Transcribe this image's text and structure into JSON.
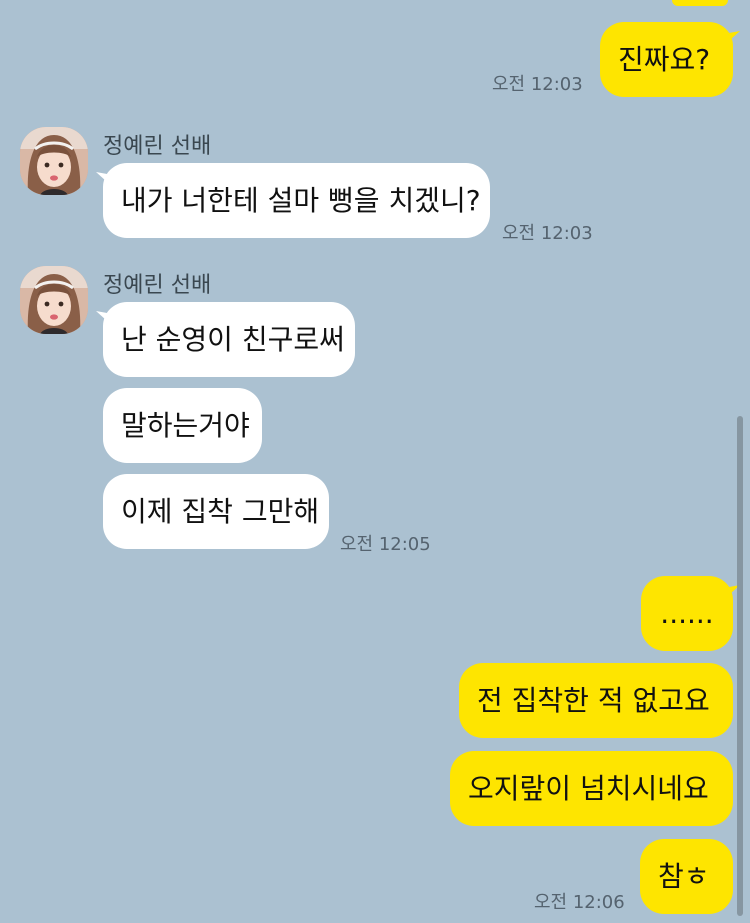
{
  "messages": {
    "out_top": {
      "text": "진짜요?",
      "time": "오전 12:03"
    },
    "group1": {
      "sender": "정예린 선배",
      "text": "내가 너한테 설마 뻥을 치겠니?",
      "time": "오전 12:03"
    },
    "group2": {
      "sender": "정예린 선배",
      "texts": [
        "난 순영이 친구로써",
        "말하는거야",
        "이제 집착 그만해"
      ],
      "time": "오전 12:05"
    },
    "out_bottom": {
      "texts": [
        "......",
        "전 집착한 적 없고요",
        "오지랖이 넘치시네요",
        "참ㅎ"
      ],
      "time": "오전 12:06"
    }
  },
  "colors": {
    "background": "#abc1d1",
    "my_bubble": "#fee500",
    "their_bubble": "#ffffff"
  },
  "icons": {
    "avatar": "profile-photo",
    "scrollbar": "vertical-scroll-thumb"
  }
}
